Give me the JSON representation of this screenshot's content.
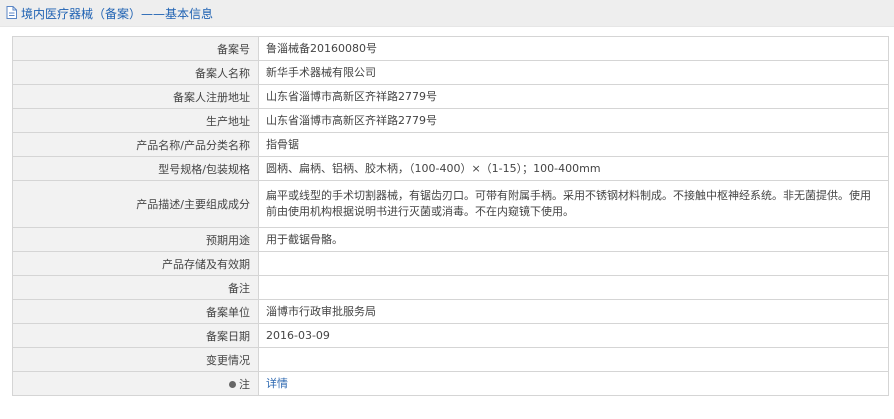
{
  "header": {
    "title": "境内医疗器械（备案）——基本信息"
  },
  "rows": [
    {
      "label": "备案号",
      "value": "鲁淄械备20160080号"
    },
    {
      "label": "备案人名称",
      "value": "新华手术器械有限公司"
    },
    {
      "label": "备案人注册地址",
      "value": "山东省淄博市高新区齐祥路2779号"
    },
    {
      "label": "生产地址",
      "value": "山东省淄博市高新区齐祥路2779号"
    },
    {
      "label": "产品名称/产品分类名称",
      "value": "指骨锯"
    },
    {
      "label": "型号规格/包装规格",
      "value": "圆柄、扁柄、铝柄、胶木柄，（100-400）×（1-15）；100-400mm"
    },
    {
      "label": "产品描述/主要组成成分",
      "value": "扁平或线型的手术切割器械，有锯齿刃口。可带有附属手柄。采用不锈钢材料制成。不接触中枢神经系统。非无菌提供。使用前由使用机构根据说明书进行灭菌或消毒。不在内窥镜下使用。"
    },
    {
      "label": "预期用途",
      "value": "用于截锯骨骼。"
    },
    {
      "label": "产品存储及有效期",
      "value": ""
    },
    {
      "label": "备注",
      "value": ""
    },
    {
      "label": "备案单位",
      "value": "淄博市行政审批服务局"
    },
    {
      "label": "备案日期",
      "value": "2016-03-09"
    },
    {
      "label": "变更情况",
      "value": ""
    }
  ],
  "note": {
    "label": "注",
    "link": "详情"
  },
  "icons": {
    "header": "document-icon",
    "note": "location-icon"
  },
  "colors": {
    "title": "#1f62b3",
    "label_bg": "#f2f2f2",
    "border": "#d5d5d5",
    "link": "#2b67b0"
  }
}
